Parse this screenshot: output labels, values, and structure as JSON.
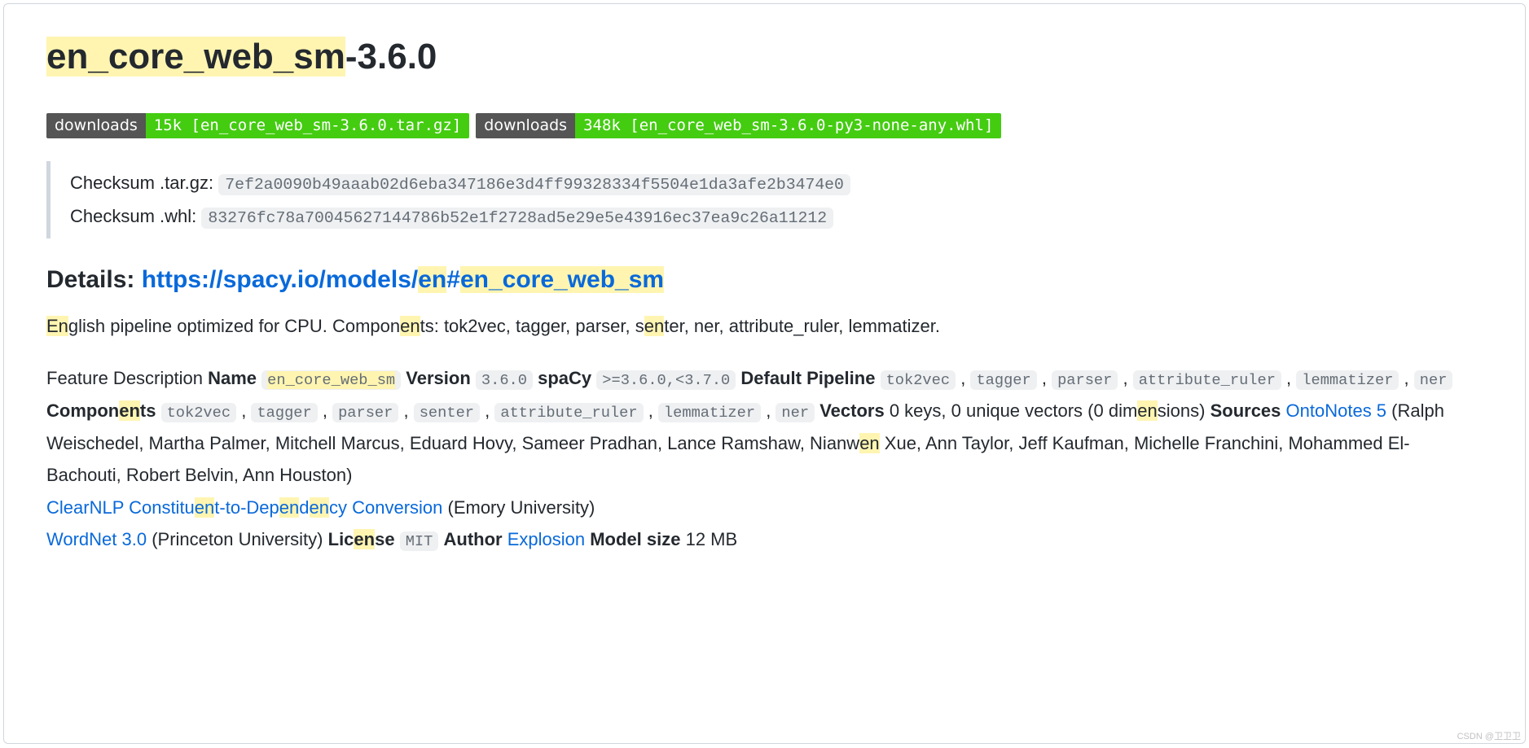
{
  "title": {
    "hl": "en_core_web_sm",
    "rest": "-3.6.0"
  },
  "badges": [
    {
      "label": "downloads",
      "value": "15k [en_core_web_sm-3.6.0.tar.gz]"
    },
    {
      "label": "downloads",
      "value": "348k [en_core_web_sm-3.6.0-py3-none-any.whl]"
    }
  ],
  "checksums": {
    "targz_label": "Checksum .tar.gz:",
    "targz_value": "7ef2a0090b49aaab02d6eba347186e3d4ff99328334f5504e1da3afe2b3474e0",
    "whl_label": "Checksum .whl:",
    "whl_value": "83276fc78a70045627144786b52e1f2728ad5e29e5e43916ec37ea9c26a11212"
  },
  "details": {
    "label": "Details: ",
    "url_pre": "https://spacy.io/models/",
    "url_hl1": "en",
    "url_mid": "#",
    "url_hl2": "en_core_web_sm"
  },
  "desc": {
    "p1a": "En",
    "p1b": "glish pipeline optimized for CPU. Compon",
    "p1c": "en",
    "p1d": "ts: tok2vec, tagger, parser, s",
    "p1e": "en",
    "p1f": "ter, ner, attribute_ruler, lemmatizer."
  },
  "feat": {
    "feature_desc": "Feature Description ",
    "name_label": "Name",
    "name_val": "en_core_web_sm",
    "version_label": "Version",
    "version_val": "3.6.0",
    "spacy_label": "spaCy",
    "spacy_val": ">=3.6.0,<3.7.0",
    "defpipe_label": "Default Pipeline",
    "comp_label_a": "Compon",
    "comp_label_b": "en",
    "comp_label_c": "ts",
    "pipe": {
      "tok2vec": "tok2vec",
      "tagger": "tagger",
      "parser": "parser",
      "attribute_ruler": "attribute_ruler",
      "lemmatizer": "lemmatizer",
      "ner": "ner",
      "senter": "senter"
    },
    "vectors_label": "Vectors",
    "vectors_a": " 0 keys, 0 unique vectors (0 dim",
    "vectors_b": "en",
    "vectors_c": "sions) ",
    "sources_label": "Sources",
    "ontonotes": "OntoNotes 5",
    "authors_a": " (Ralph Weischedel, Martha Palmer, Mitchell Marcus, Eduard Hovy, Sameer Pradhan, Lance Ramshaw, Nianw",
    "authors_b": "en",
    "authors_c": " Xue, Ann Taylor, Jeff Kaufman, Michelle Franchini, Mohammed El-Bachouti, Robert Belvin, Ann Houston)",
    "clearnlp_a": "ClearNLP Constitu",
    "clearnlp_b": "en",
    "clearnlp_c": "t-to-Dep",
    "clearnlp_d": "en",
    "clearnlp_e": "d",
    "clearnlp_f": "en",
    "clearnlp_g": "cy Conversion",
    "emory": " (Emory University)",
    "wordnet": "WordNet 3.0",
    "princeton": " (Princeton University) ",
    "license_label_a": "Lic",
    "license_label_b": "en",
    "license_label_c": "se",
    "license_val": "MIT",
    "author_label": "Author",
    "author_val": "Explosion",
    "size_label": "Model size",
    "size_val": " 12 MB"
  },
  "watermark": "CSDN @卫卫卫"
}
